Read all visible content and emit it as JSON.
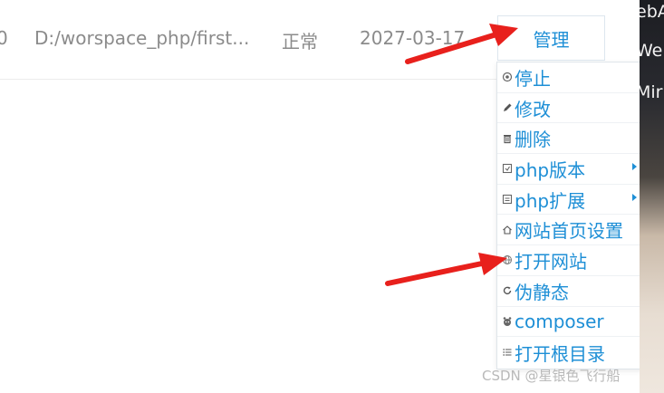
{
  "row": {
    "lead": "0",
    "path": "D:/worspace_php/first...",
    "status": "正常",
    "date": "2027-03-17"
  },
  "manage_label": "管理",
  "menu": [
    {
      "label": "停止",
      "icon": "stop-circle-icon",
      "submenu": false
    },
    {
      "label": "修改",
      "icon": "pencil-icon",
      "submenu": false
    },
    {
      "label": "删除",
      "icon": "trash-icon",
      "submenu": false
    },
    {
      "label": "php版本",
      "icon": "php-version-icon",
      "submenu": true
    },
    {
      "label": "php扩展",
      "icon": "php-extension-icon",
      "submenu": true
    },
    {
      "label": "网站首页设置",
      "icon": "home-icon",
      "submenu": false
    },
    {
      "label": "打开网站",
      "icon": "globe-icon",
      "submenu": false
    },
    {
      "label": "伪静态",
      "icon": "refresh-icon",
      "submenu": false
    },
    {
      "label": "composer",
      "icon": "composer-icon",
      "submenu": false
    },
    {
      "label": "打开根目录",
      "icon": "list-icon",
      "submenu": false
    }
  ],
  "strip_text": [
    "ebA",
    "We",
    "Mir"
  ],
  "watermark": "CSDN @星银色飞行船",
  "colors": {
    "accent": "#1e8fd6",
    "arrow": "#e8201c"
  }
}
